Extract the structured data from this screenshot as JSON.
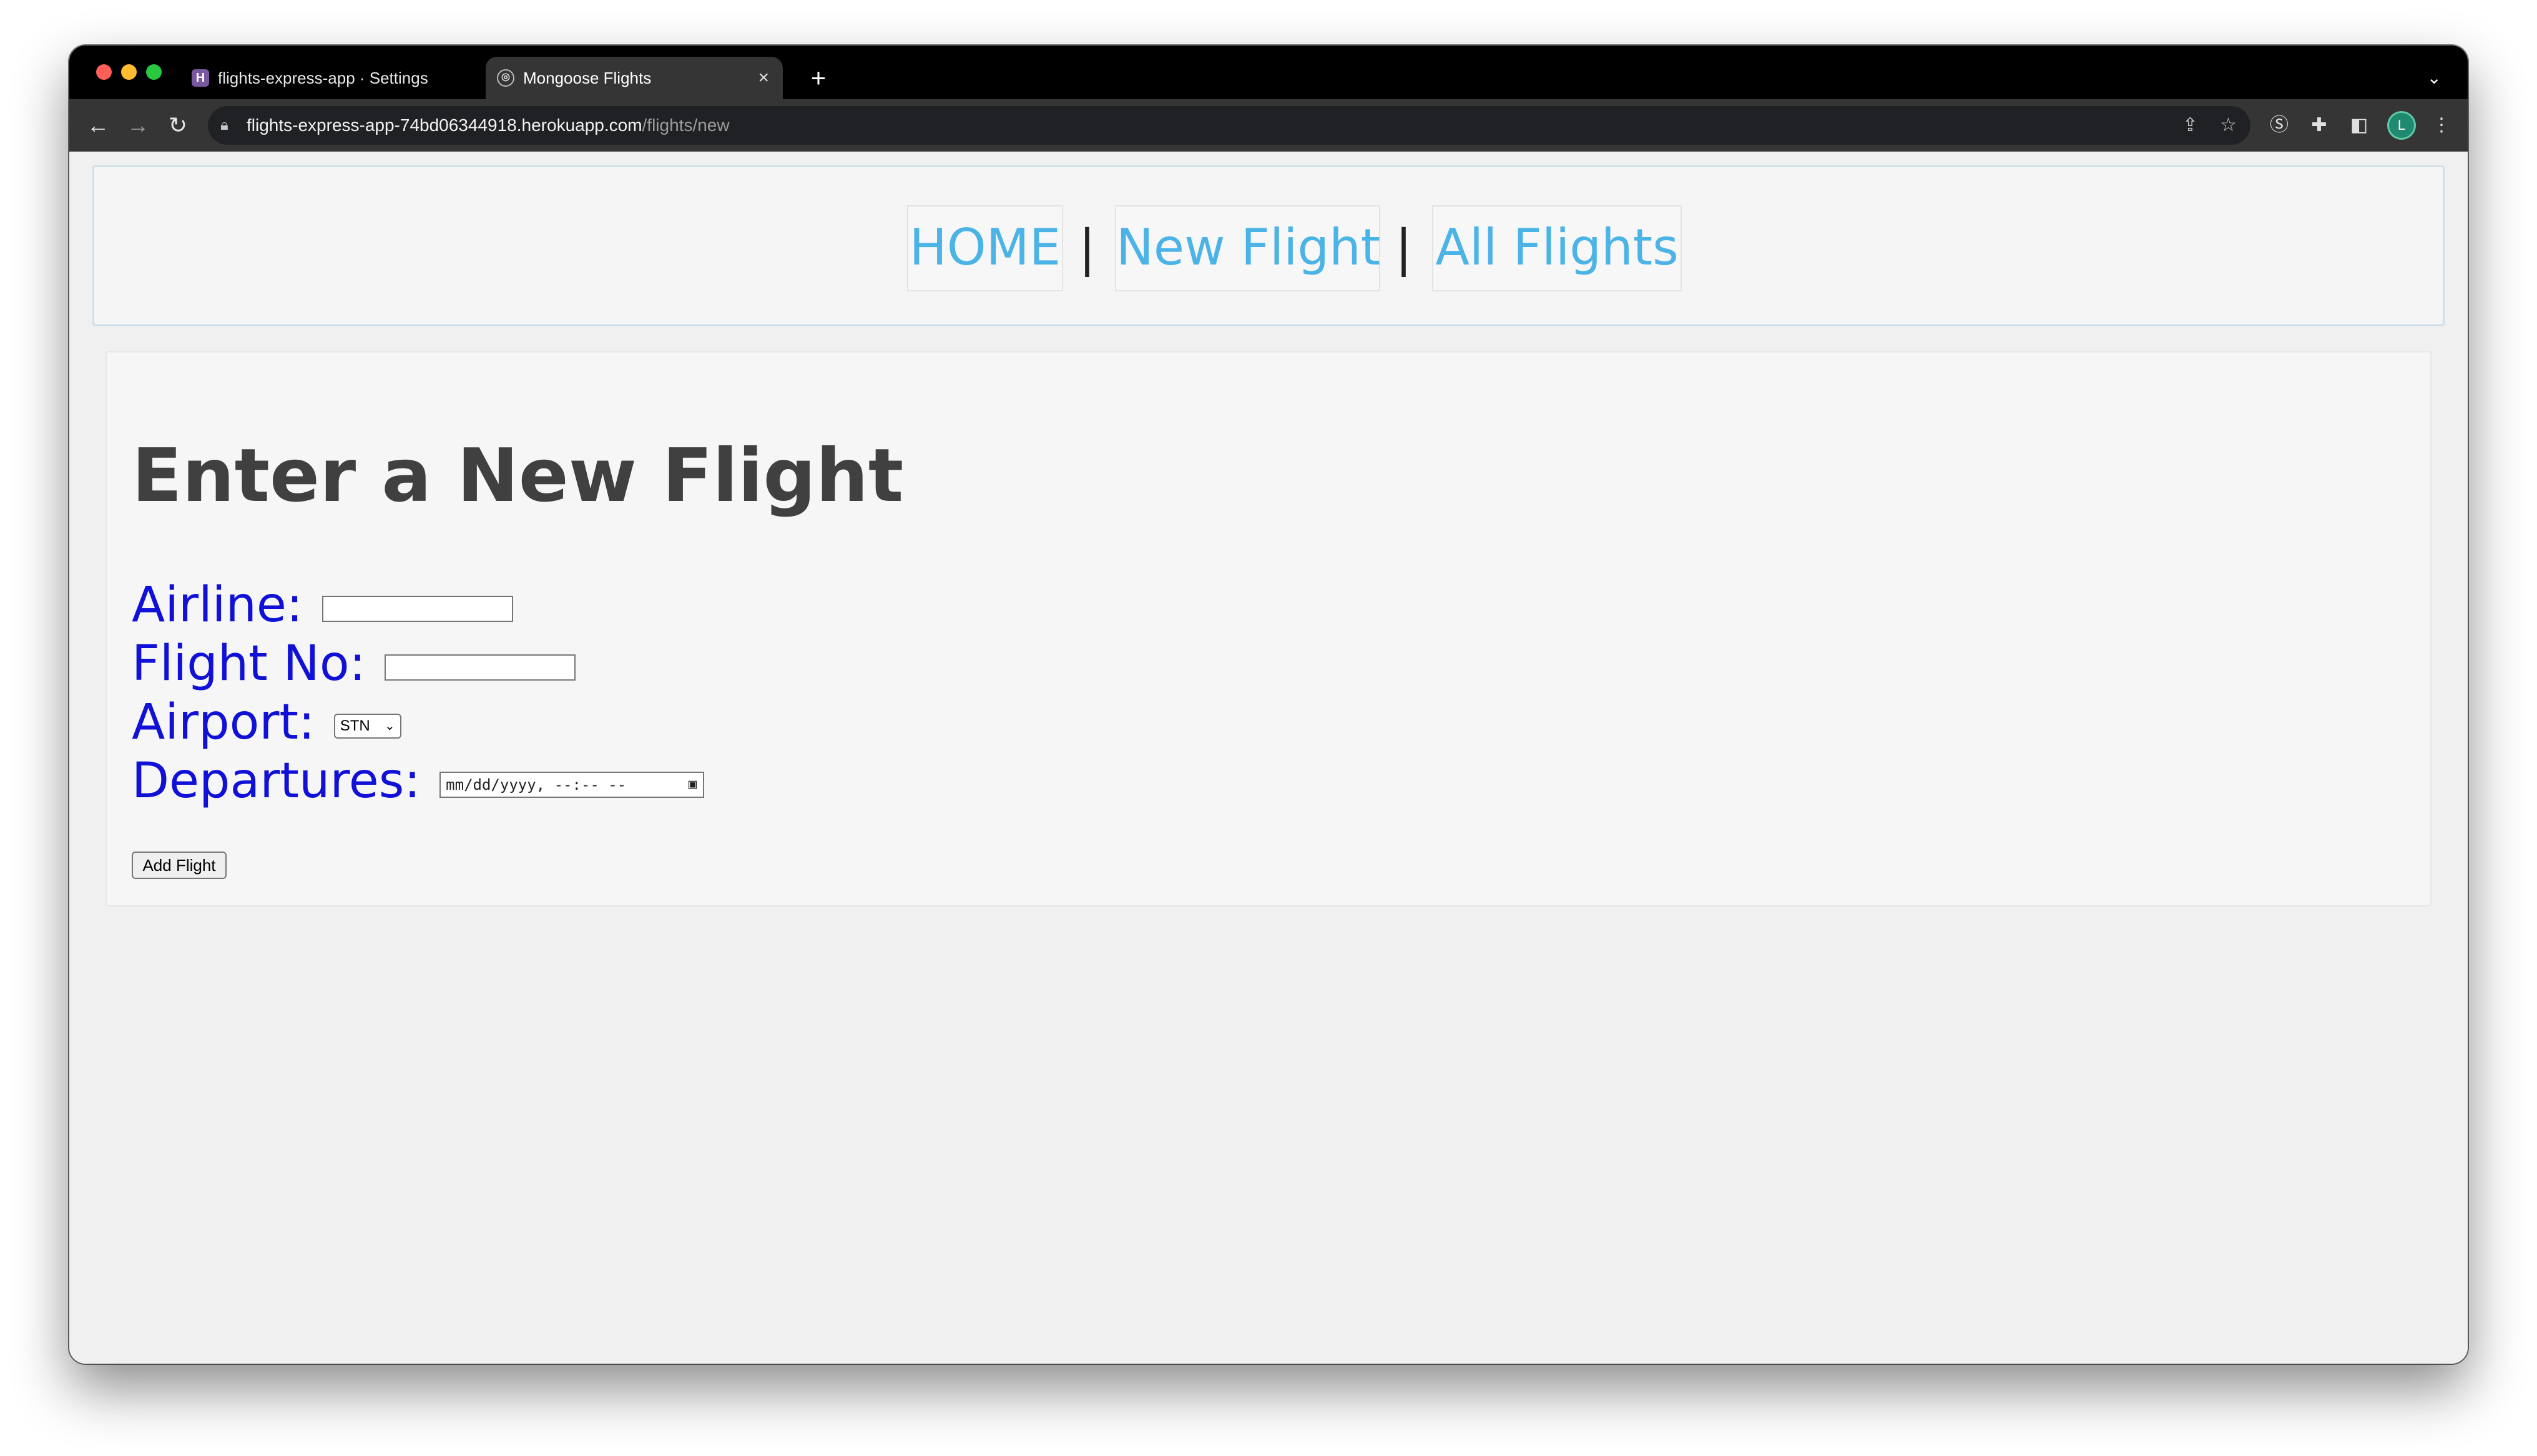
{
  "browser": {
    "tabs": [
      {
        "title": "flights-express-app · Settings",
        "favicon": "heroku-icon",
        "active": false
      },
      {
        "title": "Mongoose Flights",
        "favicon": "globe-icon",
        "active": true
      }
    ],
    "new_tab_label": "+",
    "url_host": "flights-express-app-74bd06344918.herokuapp.com",
    "url_path": "/flights/new",
    "profile_initial": "L"
  },
  "nav": {
    "home": "HOME",
    "separator": "|",
    "new_flight": "New Flight",
    "all_flights": "All Flights"
  },
  "form": {
    "heading": "Enter a New Flight",
    "airline_label": "Airline:",
    "airline_value": "",
    "flight_no_label": "Flight No:",
    "flight_no_value": "",
    "airport_label": "Airport:",
    "airport_selected": "STN",
    "departures_label": "Departures:",
    "departures_placeholder": "mm/dd/yyyy, --:-- --",
    "submit_label": "Add Flight"
  },
  "colors": {
    "nav_link": "#4cb3e6",
    "label": "#1010d6",
    "heading": "#404040"
  }
}
